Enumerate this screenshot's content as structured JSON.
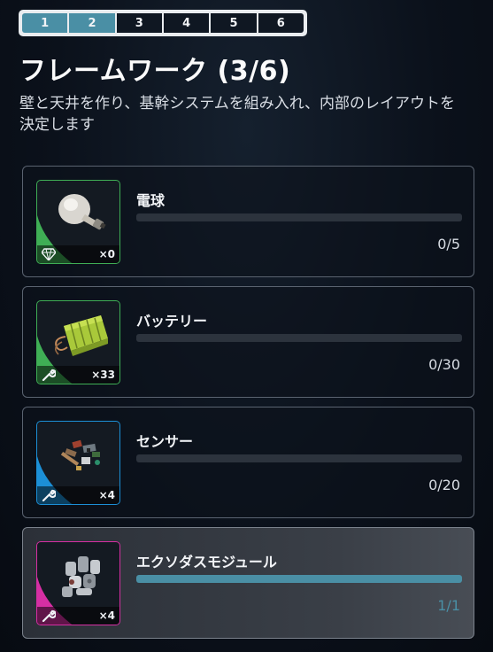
{
  "steps": [
    "1",
    "2",
    "3",
    "4",
    "5",
    "6"
  ],
  "steps_done": 2,
  "title": "フレームワーク (3/6)",
  "description": "壁と天井を作り、基幹システムを組み入れ、内部のレイアウトを決定します",
  "items": [
    {
      "name": "電球",
      "count_label": "×0",
      "progress_label": "0/5",
      "current": 0,
      "required": 5,
      "rarity_color": "#3fae55",
      "kind_icon": "diamond-icon",
      "art": "bulb"
    },
    {
      "name": "バッテリー",
      "count_label": "×33",
      "progress_label": "0/30",
      "current": 0,
      "required": 30,
      "rarity_color": "#3fae55",
      "kind_icon": "wrench-icon",
      "art": "battery"
    },
    {
      "name": "センサー",
      "count_label": "×4",
      "progress_label": "0/20",
      "current": 0,
      "required": 20,
      "rarity_color": "#1c8fd6",
      "kind_icon": "wrench-icon",
      "art": "sensors"
    },
    {
      "name": "エクソダスモジュール",
      "count_label": "×4",
      "progress_label": "1/1",
      "current": 1,
      "required": 1,
      "rarity_color": "#d62fa3",
      "kind_icon": "wrench-icon",
      "art": "module"
    }
  ]
}
